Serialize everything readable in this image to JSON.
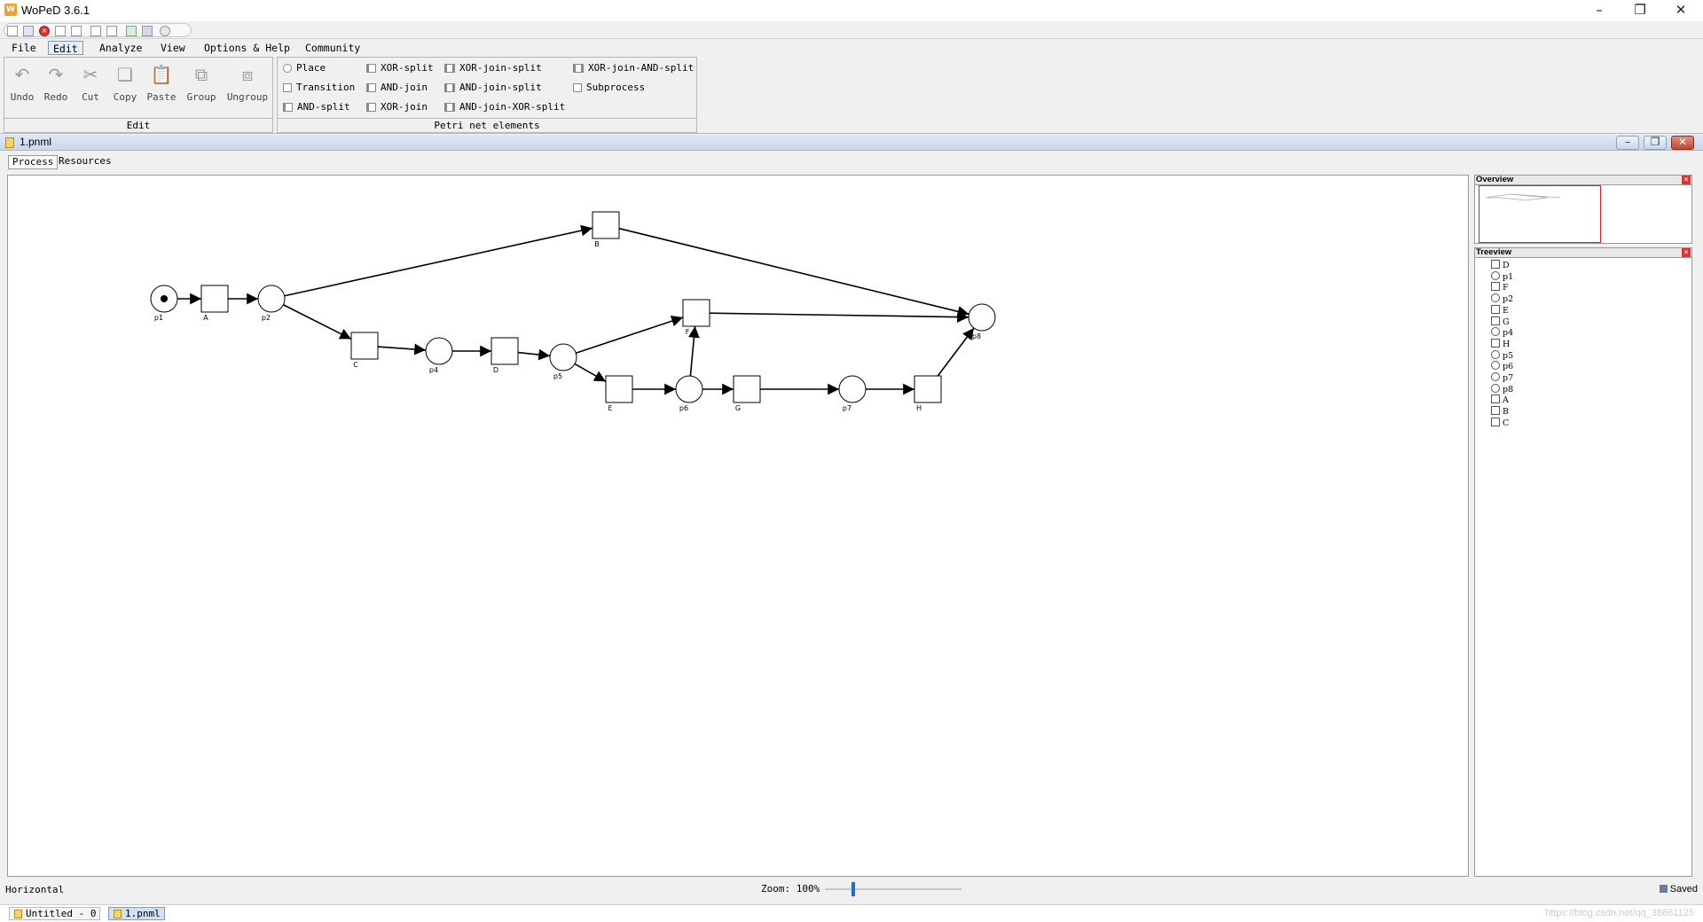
{
  "window": {
    "title": "WoPeD 3.6.1",
    "minimize": "–",
    "restore": "❐",
    "close": "✕"
  },
  "menu": [
    "File",
    "Edit",
    "Analyze",
    "View",
    "Options & Help",
    "Community"
  ],
  "ribbon": {
    "edit_group": "Edit",
    "buttons": {
      "undo": "Undo",
      "redo": "Redo",
      "cut": "Cut",
      "copy": "Copy",
      "paste": "Paste",
      "group": "Group",
      "ungroup": "Ungroup"
    },
    "petri_group": "Petri net elements",
    "elements": {
      "place": "Place",
      "transition": "Transition",
      "and_split": "AND-split",
      "xor_split": "XOR-split",
      "and_join": "AND-join",
      "xor_join": "XOR-join",
      "xor_join_split": "XOR-join-split",
      "and_join_split": "AND-join-split",
      "and_join_xor_split": "AND-join-XOR-split",
      "xor_join_and_split": "XOR-join-AND-split",
      "subprocess": "Subprocess"
    }
  },
  "document": {
    "title": "1.pnml",
    "tabs": [
      "Process",
      "Resources"
    ]
  },
  "net": {
    "places": [
      {
        "id": "p1",
        "label": "p1",
        "token": true
      },
      {
        "id": "p2",
        "label": "p2"
      },
      {
        "id": "p4",
        "label": "p4"
      },
      {
        "id": "p5",
        "label": "p5"
      },
      {
        "id": "p6",
        "label": "p6"
      },
      {
        "id": "p7",
        "label": "p7"
      },
      {
        "id": "p8",
        "label": "p8"
      }
    ],
    "transitions": [
      "A",
      "B",
      "C",
      "D",
      "E",
      "F",
      "G",
      "H"
    ],
    "arcs": [
      [
        "p1",
        "A"
      ],
      [
        "A",
        "p2"
      ],
      [
        "p2",
        "B"
      ],
      [
        "B",
        "p8"
      ],
      [
        "p2",
        "C"
      ],
      [
        "C",
        "p4"
      ],
      [
        "p4",
        "D"
      ],
      [
        "D",
        "p5"
      ],
      [
        "p5",
        "F"
      ],
      [
        "p5",
        "E"
      ],
      [
        "F",
        "p8"
      ],
      [
        "E",
        "p6"
      ],
      [
        "p6",
        "F"
      ],
      [
        "p6",
        "G"
      ],
      [
        "G",
        "p7"
      ],
      [
        "p7",
        "H"
      ],
      [
        "H",
        "p8"
      ]
    ]
  },
  "side": {
    "overview": "Overview",
    "treeview": "Treeview",
    "tree": [
      {
        "type": "transition",
        "label": "D"
      },
      {
        "type": "place",
        "label": "p1"
      },
      {
        "type": "transition",
        "label": "F"
      },
      {
        "type": "place",
        "label": "p2"
      },
      {
        "type": "transition",
        "label": "E"
      },
      {
        "type": "transition",
        "label": "G"
      },
      {
        "type": "place",
        "label": "p4"
      },
      {
        "type": "transition",
        "label": "H"
      },
      {
        "type": "place",
        "label": "p5"
      },
      {
        "type": "place",
        "label": "p6"
      },
      {
        "type": "place",
        "label": "p7"
      },
      {
        "type": "place",
        "label": "p8"
      },
      {
        "type": "transition",
        "label": "A"
      },
      {
        "type": "transition",
        "label": "B"
      },
      {
        "type": "transition",
        "label": "C"
      }
    ]
  },
  "status": {
    "layout": "Horizontal",
    "zoom_label": "Zoom: 100%",
    "zoom_percent": 100,
    "saved": "Saved"
  },
  "windows": [
    "Untitled - 0",
    "1.pnml"
  ],
  "watermark": "https://blog.csdn.net/qq_38661125"
}
